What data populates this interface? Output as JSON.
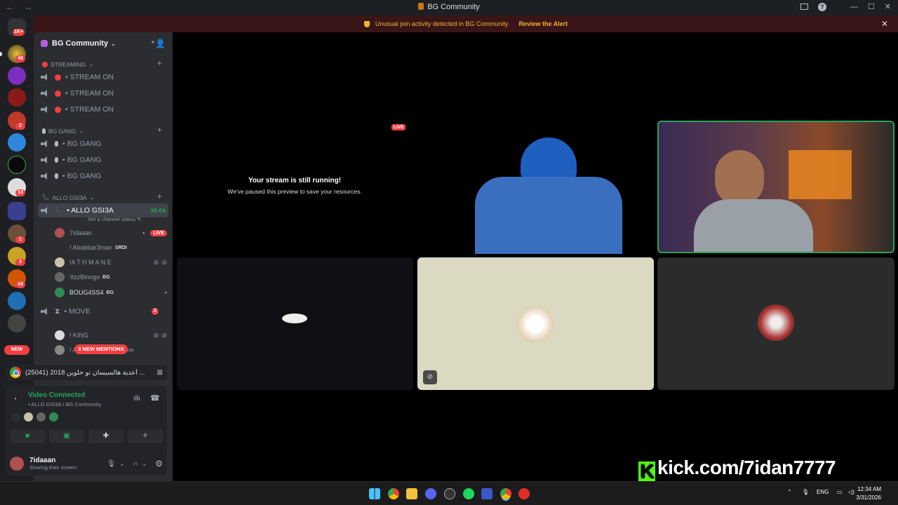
{
  "window": {
    "title": "BG Community",
    "nav_back": "←",
    "nav_fwd": "→"
  },
  "banner": {
    "message": "Unusual join activity detected in BG Community",
    "action": "Review the Alert"
  },
  "rail": {
    "home_badge": "1K+",
    "badges": [
      "48",
      "2",
      "13",
      "1",
      "3",
      "43"
    ],
    "new_label": "NEW"
  },
  "server": {
    "name": "BG Community"
  },
  "categories": [
    {
      "label": "STREAMING",
      "channels": [
        "• STREAM ON",
        "• STREAM ON",
        "• STREAM ON"
      ]
    },
    {
      "label": "BG GANG",
      "channels": [
        "• BG GANG",
        "• BG GANG",
        "• BG GANG"
      ]
    },
    {
      "label": "ALLO GSI3A"
    }
  ],
  "active_channel": {
    "name": "• ALLO GSI3A",
    "timer": "36:04",
    "status": "Set a channel status"
  },
  "voice_users": [
    {
      "name": "7idaaan",
      "tag": "LIVE"
    },
    {
      "name": "! Ababbar3man",
      "tag": "SRDI"
    },
    {
      "name": "!A T H M A N E",
      "tag": ""
    },
    {
      "name": "'itzzBinngo",
      "tag": "BG"
    },
    {
      "name": "BOUG4SS4",
      "tag": "BG"
    }
  ],
  "move_channel": {
    "name": "• MOVE",
    "count": "2"
  },
  "move_users": [
    {
      "name": "! KING",
      "tag": ""
    },
    {
      "name": "! A",
      "tag": "ssa"
    }
  ],
  "mentions_label": "3 NEW MENTIONS",
  "stream_tab": {
    "title": "(25041) 2018 أعدية هالسيسان تو حلوين ..."
  },
  "voice_panel": {
    "connected": "Video Connected",
    "channel": "• ALLO GSI3A / BG Community"
  },
  "me": {
    "name": "7idaaan",
    "status": "Sharing their screen"
  },
  "stream": {
    "live": "LIVE",
    "paused_title": "Your stream is still running!",
    "paused_sub": "We've paused this preview to save your resources."
  },
  "overlay": {
    "kick": "kick.com/7idan7777",
    "kick_logo": "K"
  },
  "taskbar": {
    "lang": "ENG",
    "time": "12:34 AM",
    "date": "3/31/2026"
  },
  "colors": {
    "accent_green": "#23a559",
    "alert_yellow": "#f0b232",
    "danger": "#f23f42",
    "kick_green": "#53fc18"
  }
}
